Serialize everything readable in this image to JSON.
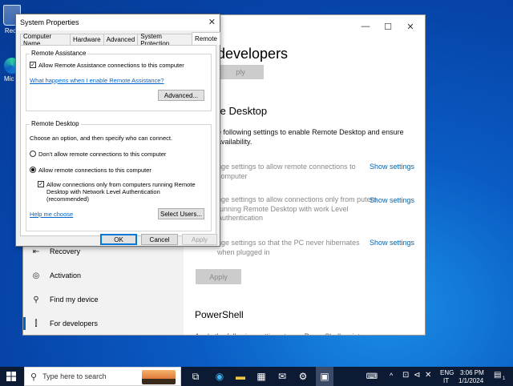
{
  "desktop": {
    "recycle_label": "Recy",
    "edge_label": "Mic E"
  },
  "settings": {
    "window_controls": [
      "—",
      "☐",
      "✕"
    ],
    "heading": "developers",
    "apply_top": "ply",
    "remote_desktop_title": "te Desktop",
    "remote_desktop_desc": "e following settings to enable Remote Desktop and ensure availability.",
    "setting1": "nge settings to allow remote connections to computer",
    "setting2": "nge settings to allow connections only from puters running Remote Desktop with work Level Authentication",
    "setting3": "nge settings so that the PC never hibernates when plugged in",
    "show_settings": "Show settings",
    "apply": "Apply",
    "powershell": "PowerShell",
    "powershell_desc": "Apply the following settings to run PowerShell scripts",
    "nav": [
      {
        "label": "Recovery",
        "icon": "recovery-icon"
      },
      {
        "label": "Activation",
        "icon": "activation-icon"
      },
      {
        "label": "Find my device",
        "icon": "find-device-icon"
      },
      {
        "label": "For developers",
        "icon": "developers-icon"
      }
    ]
  },
  "dialog": {
    "title": "System Properties",
    "tabs": [
      "Computer Name",
      "Hardware",
      "Advanced",
      "System Protection",
      "Remote"
    ],
    "active_tab": "Remote",
    "remote_assistance": {
      "legend": "Remote Assistance",
      "checkbox": "Allow Remote Assistance connections to this computer",
      "checked": true,
      "link": "What happens when I enable Remote Assistance?",
      "advanced": "Advanced..."
    },
    "remote_desktop": {
      "legend": "Remote Desktop",
      "prompt": "Choose an option, and then specify who can connect.",
      "option_no": "Don't allow remote connections to this computer",
      "option_yes": "Allow remote connections to this computer",
      "selected": "option_yes",
      "nla_checkbox": "Allow connections only from computers running Remote Desktop with Network Level Authentication (recommended)",
      "nla_checked": true,
      "help_link": "Help me choose",
      "select_users": "Select Users..."
    },
    "ok": "OK",
    "cancel": "Cancel",
    "apply": "Apply"
  },
  "taskbar": {
    "search_placeholder": "Type here to search",
    "language": "ENG",
    "region": "IT",
    "time": "3:06 PM",
    "date": "1/1/2024",
    "notification_count": "1"
  },
  "colors": {
    "accent": "#0067c0",
    "link": "#0066cc",
    "taskbar": "#0c1a33"
  }
}
